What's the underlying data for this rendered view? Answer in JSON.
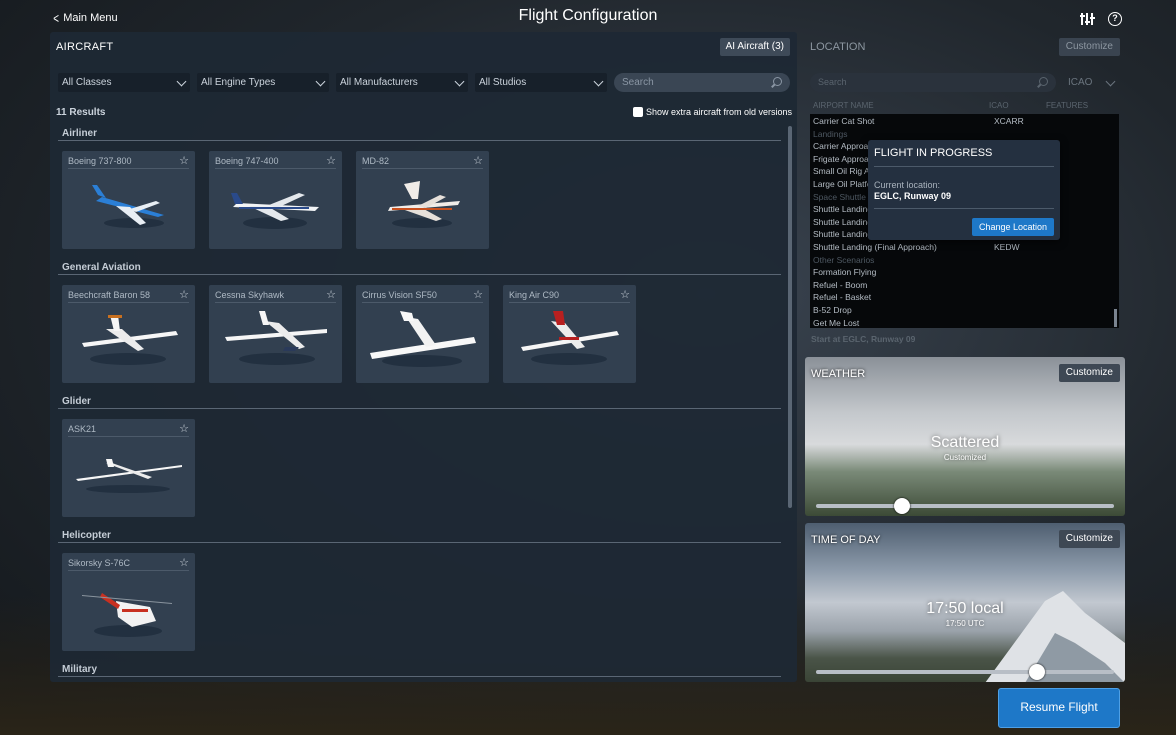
{
  "topbar": {
    "back_label": "Main Menu",
    "title": "Flight Configuration"
  },
  "aircraft": {
    "title": "AIRCRAFT",
    "ai_button": "AI Aircraft (3)",
    "filters": [
      "All Classes",
      "All Engine Types",
      "All Manufacturers",
      "All Studios"
    ],
    "search_placeholder": "Search",
    "results": "11 Results",
    "extra_label": "Show extra aircraft from old versions",
    "categories": [
      {
        "name": "Airliner",
        "items": [
          "Boeing 737-800",
          "Boeing 747-400",
          "MD-82"
        ]
      },
      {
        "name": "General Aviation",
        "items": [
          "Beechcraft Baron 58",
          "Cessna Skyhawk",
          "Cirrus Vision SF50",
          "King Air C90"
        ]
      },
      {
        "name": "Glider",
        "items": [
          "ASK21"
        ]
      },
      {
        "name": "Helicopter",
        "items": [
          "Sikorsky S-76C"
        ]
      },
      {
        "name": "Military",
        "items": []
      }
    ]
  },
  "location": {
    "title": "LOCATION",
    "customize": "Customize",
    "search_placeholder": "Search",
    "icao_select": "ICAO",
    "columns": [
      "AIRPORT NAME",
      "ICAO",
      "FEATURES"
    ],
    "rows": [
      {
        "name": "Carrier Cat Shot",
        "icao": "XCARR"
      },
      {
        "name": "Landings",
        "section": true
      },
      {
        "name": "Carrier Approach"
      },
      {
        "name": "Frigate Approach"
      },
      {
        "name": "Small Oil Rig A"
      },
      {
        "name": "Large Oil Platfo"
      },
      {
        "name": "Space Shuttle",
        "section": true
      },
      {
        "name": "Shuttle Landing"
      },
      {
        "name": "Shuttle Landing"
      },
      {
        "name": "Shuttle Landing"
      },
      {
        "name": "Shuttle Landing (Final Approach)",
        "icao": "KEDW"
      },
      {
        "name": "Other Scenarios",
        "section": true
      },
      {
        "name": "Formation Flying"
      },
      {
        "name": "Refuel - Boom"
      },
      {
        "name": "Refuel - Basket"
      },
      {
        "name": "B-52 Drop"
      },
      {
        "name": "Get Me Lost"
      }
    ],
    "start": "Start at EGLC, Runway 09"
  },
  "popup": {
    "title": "FLIGHT IN PROGRESS",
    "label": "Current location:",
    "value": "EGLC, Runway 09",
    "button": "Change Location"
  },
  "weather": {
    "title": "WEATHER",
    "customize": "Customize",
    "value": "Scattered",
    "sub": "Customized",
    "slider": 0.29
  },
  "timeofday": {
    "title": "TIME OF DAY",
    "customize": "Customize",
    "value": "17:50 local",
    "sub": "17:50 UTC",
    "slider": 0.74
  },
  "resume_label": "Resume Flight",
  "colors": {
    "accent": "#1e78c8",
    "panel": "#1e2834",
    "card": "#324050"
  }
}
